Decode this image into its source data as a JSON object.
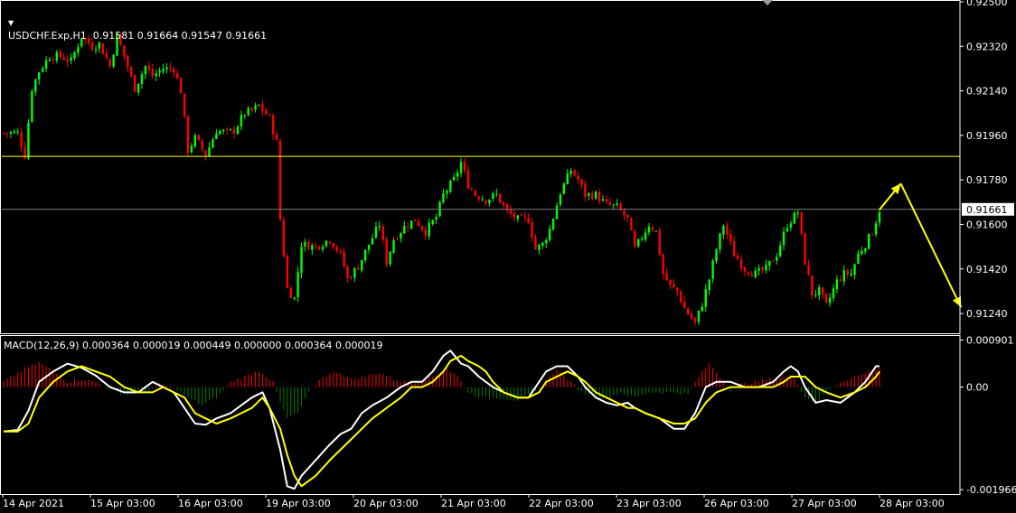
{
  "header": {
    "symbol_line": "USDCHF.Exp,H1  0.91581 0.91664 0.91547 0.91661",
    "macd_line": "MACD(12,26,9) 0.000364 0.000019 0.000449 0.000000 0.000364 0.000019"
  },
  "colors": {
    "background": "#000000",
    "axis": "#ffffff",
    "bull_candle": "#00ff00",
    "bear_candle": "#ff0000",
    "level_line": "#ffff00",
    "price_line": "#808080",
    "arrow": "#ffff00",
    "macd_main": "#ffffff",
    "macd_signal": "#ffff00",
    "hist_positive": "#ff0000",
    "hist_negative": "#008000"
  },
  "chart_data": [
    {
      "type": "candlestick",
      "title": "USDCHF.Exp,H1",
      "timeframe": "H1",
      "last_price_label": "0.91661",
      "ylim": [
        0.9116,
        0.925
      ],
      "y_ticks": [
        "0.92500",
        "0.92320",
        "0.92140",
        "0.91960",
        "0.91780",
        "0.91600",
        "0.91420",
        "0.91240"
      ],
      "y_tick_values": [
        0.925,
        0.9232,
        0.9214,
        0.9196,
        0.9178,
        0.916,
        0.9142,
        0.9124
      ],
      "x_ticks": [
        "14 Apr 2021",
        "15 Apr 03:00",
        "16 Apr 03:00",
        "19 Apr 03:00",
        "20 Apr 03:00",
        "21 Apr 03:00",
        "22 Apr 03:00",
        "23 Apr 03:00",
        "26 Apr 03:00",
        "27 Apr 03:00",
        "28 Apr 03:00"
      ],
      "close_path": [
        [
          0,
          0.9197
        ],
        [
          4,
          0.9197
        ],
        [
          6,
          0.9188
        ],
        [
          8,
          0.9215
        ],
        [
          10,
          0.9222
        ],
        [
          13,
          0.9228
        ],
        [
          16,
          0.9228
        ],
        [
          19,
          0.9226
        ],
        [
          22,
          0.9236
        ],
        [
          25,
          0.9232
        ],
        [
          27,
          0.9233
        ],
        [
          30,
          0.9224
        ],
        [
          32,
          0.9236
        ],
        [
          34,
          0.9228
        ],
        [
          37,
          0.9215
        ],
        [
          40,
          0.9224
        ],
        [
          42,
          0.922
        ],
        [
          45,
          0.9223
        ],
        [
          48,
          0.9223
        ],
        [
          50,
          0.9214
        ],
        [
          52,
          0.919
        ],
        [
          54,
          0.9195
        ],
        [
          57,
          0.9188
        ],
        [
          60,
          0.9198
        ],
        [
          63,
          0.9197
        ],
        [
          65,
          0.9198
        ],
        [
          68,
          0.9205
        ],
        [
          70,
          0.9206
        ],
        [
          72,
          0.9208
        ],
        [
          75,
          0.9203
        ],
        [
          77,
          0.9193
        ],
        [
          78,
          0.9162
        ],
        [
          80,
          0.9134
        ],
        [
          82,
          0.913
        ],
        [
          84,
          0.9152
        ],
        [
          88,
          0.9151
        ],
        [
          92,
          0.9154
        ],
        [
          95,
          0.9148
        ],
        [
          97,
          0.9138
        ],
        [
          100,
          0.9143
        ],
        [
          103,
          0.9152
        ],
        [
          106,
          0.916
        ],
        [
          108,
          0.9145
        ],
        [
          110,
          0.9154
        ],
        [
          113,
          0.9159
        ],
        [
          116,
          0.9162
        ],
        [
          119,
          0.9157
        ],
        [
          122,
          0.9163
        ],
        [
          124,
          0.9172
        ],
        [
          127,
          0.9178
        ],
        [
          129,
          0.9185
        ],
        [
          131,
          0.9176
        ],
        [
          133,
          0.9172
        ],
        [
          136,
          0.917
        ],
        [
          139,
          0.9172
        ],
        [
          142,
          0.9165
        ],
        [
          145,
          0.9162
        ],
        [
          148,
          0.9162
        ],
        [
          150,
          0.915
        ],
        [
          152,
          0.9152
        ],
        [
          154,
          0.9158
        ],
        [
          157,
          0.9173
        ],
        [
          160,
          0.9182
        ],
        [
          162,
          0.9178
        ],
        [
          164,
          0.9172
        ],
        [
          167,
          0.9172
        ],
        [
          170,
          0.9168
        ],
        [
          173,
          0.9167
        ],
        [
          176,
          0.9162
        ],
        [
          178,
          0.915
        ],
        [
          180,
          0.9155
        ],
        [
          182,
          0.916
        ],
        [
          184,
          0.9157
        ],
        [
          186,
          0.914
        ],
        [
          188,
          0.9135
        ],
        [
          190,
          0.9133
        ],
        [
          192,
          0.9126
        ],
        [
          195,
          0.912
        ],
        [
          197,
          0.9128
        ],
        [
          199,
          0.9138
        ],
        [
          201,
          0.915
        ],
        [
          203,
          0.916
        ],
        [
          206,
          0.9148
        ],
        [
          209,
          0.9142
        ],
        [
          212,
          0.914
        ],
        [
          215,
          0.9142
        ],
        [
          218,
          0.9148
        ],
        [
          221,
          0.916
        ],
        [
          224,
          0.9165
        ],
        [
          226,
          0.9145
        ],
        [
          228,
          0.9132
        ],
        [
          230,
          0.9133
        ],
        [
          232,
          0.9127
        ],
        [
          235,
          0.9137
        ],
        [
          237,
          0.914
        ],
        [
          239,
          0.914
        ],
        [
          241,
          0.9148
        ],
        [
          243,
          0.9152
        ],
        [
          245,
          0.9157
        ],
        [
          247,
          0.9166
        ]
      ],
      "horizontal_lines": [
        {
          "name": "level",
          "value": 0.91875,
          "color": "#ffff00"
        },
        {
          "name": "current-price",
          "value": 0.91661,
          "color": "#808080"
        }
      ],
      "forecast_arrows": [
        {
          "from": [
            247,
            0.9166
          ],
          "to": [
            253,
            0.91765
          ]
        },
        {
          "from": [
            253,
            0.91765
          ],
          "to": [
            270,
            0.91265
          ]
        }
      ]
    },
    {
      "type": "macd",
      "title": "MACD(12,26,9)",
      "params": [
        12,
        26,
        9
      ],
      "ylim": [
        -0.00205,
        0.00098
      ],
      "y_ticks": [
        "0.000901",
        "0.00",
        "-0.001966"
      ],
      "y_tick_values": [
        0.000901,
        0.0,
        -0.001966
      ],
      "histogram": [
        [
          0,
          0.0001
        ],
        [
          6,
          0.00035
        ],
        [
          10,
          0.00047
        ],
        [
          14,
          0.0003
        ],
        [
          18,
          0.0001
        ],
        [
          22,
          0.00015
        ],
        [
          26,
          0.0001
        ],
        [
          30,
          -5e-05
        ],
        [
          35,
          -0.00015
        ],
        [
          40,
          -0.0001
        ],
        [
          44,
          5e-05
        ],
        [
          48,
          0.0
        ],
        [
          52,
          -0.0002
        ],
        [
          56,
          -0.00035
        ],
        [
          60,
          -0.0002
        ],
        [
          64,
          0.0001
        ],
        [
          68,
          0.0002
        ],
        [
          72,
          0.00032
        ],
        [
          76,
          0.0001
        ],
        [
          78,
          -0.0003
        ],
        [
          80,
          -0.0006
        ],
        [
          83,
          -0.0005
        ],
        [
          86,
          -0.0001
        ],
        [
          90,
          0.0002
        ],
        [
          94,
          0.0003
        ],
        [
          98,
          0.00015
        ],
        [
          102,
          0.0002
        ],
        [
          106,
          0.00028
        ],
        [
          110,
          0.00015
        ],
        [
          113,
          0.0001
        ],
        [
          117,
          0.0001
        ],
        [
          121,
          0.0002
        ],
        [
          125,
          0.00035
        ],
        [
          128,
          0.0002
        ],
        [
          131,
          -0.0001
        ],
        [
          135,
          -0.0002
        ],
        [
          140,
          -0.0002
        ],
        [
          145,
          -0.00025
        ],
        [
          150,
          -0.0001
        ],
        [
          153,
          0.0001
        ],
        [
          156,
          0.00035
        ],
        [
          159,
          0.00015
        ],
        [
          163,
          -0.0001
        ],
        [
          166,
          -0.00015
        ],
        [
          170,
          -0.0002
        ],
        [
          174,
          -0.0001
        ],
        [
          178,
          -0.0002
        ],
        [
          182,
          -0.0001
        ],
        [
          186,
          -0.0001
        ],
        [
          190,
          -0.0001
        ],
        [
          193,
          -0.00015
        ],
        [
          196,
          0.0002
        ],
        [
          199,
          0.00045
        ],
        [
          202,
          0.0002
        ],
        [
          205,
          -5e-05
        ],
        [
          208,
          5e-05
        ],
        [
          212,
          0.0001
        ],
        [
          216,
          0.00015
        ],
        [
          220,
          0.0002
        ],
        [
          223,
          0.0002
        ],
        [
          226,
          -0.0002
        ],
        [
          229,
          -0.0003
        ],
        [
          232,
          -0.0001
        ],
        [
          236,
          0.0001
        ],
        [
          240,
          0.0002
        ],
        [
          244,
          0.0003
        ],
        [
          247,
          0.00036
        ]
      ],
      "main": [
        [
          0,
          -0.00085
        ],
        [
          4,
          -0.00082
        ],
        [
          7,
          -0.00045
        ],
        [
          10,
          0.0001
        ],
        [
          14,
          0.0003
        ],
        [
          18,
          0.00045
        ],
        [
          22,
          0.00037
        ],
        [
          26,
          0.00022
        ],
        [
          30,
          0.0
        ],
        [
          34,
          -0.0001
        ],
        [
          38,
          -0.0001
        ],
        [
          42,
          0.0001
        ],
        [
          45,
          0.0
        ],
        [
          48,
          -0.0001
        ],
        [
          51,
          -0.0004
        ],
        [
          54,
          -0.0007
        ],
        [
          57,
          -0.00072
        ],
        [
          60,
          -0.0006
        ],
        [
          64,
          -0.0005
        ],
        [
          67,
          -0.00035
        ],
        [
          70,
          -0.0002
        ],
        [
          73,
          -0.0001
        ],
        [
          75,
          -0.0004
        ],
        [
          78,
          -0.0012
        ],
        [
          80,
          -0.0019
        ],
        [
          82,
          -0.00195
        ],
        [
          84,
          -0.0017
        ],
        [
          88,
          -0.0014
        ],
        [
          92,
          -0.0011
        ],
        [
          95,
          -0.0009
        ],
        [
          98,
          -0.0008
        ],
        [
          101,
          -0.0005
        ],
        [
          104,
          -0.00035
        ],
        [
          108,
          -0.0002
        ],
        [
          112,
          0.0
        ],
        [
          115,
          0.0001
        ],
        [
          118,
          0.0001
        ],
        [
          121,
          0.0003
        ],
        [
          124,
          0.0006
        ],
        [
          126,
          0.0007
        ],
        [
          129,
          0.00045
        ],
        [
          131,
          0.0004
        ],
        [
          134,
          0.0002
        ],
        [
          136,
          0.0001
        ],
        [
          138,
          0.0
        ],
        [
          141,
          -0.0001
        ],
        [
          145,
          -0.0002
        ],
        [
          148,
          -0.0002
        ],
        [
          151,
          0.0001
        ],
        [
          153,
          0.0003
        ],
        [
          156,
          0.0004
        ],
        [
          159,
          0.0004
        ],
        [
          162,
          0.0002
        ],
        [
          164,
          0.0
        ],
        [
          167,
          -0.0002
        ],
        [
          170,
          -0.0003
        ],
        [
          173,
          -0.00035
        ],
        [
          176,
          -0.0003
        ],
        [
          178,
          -0.0004
        ],
        [
          181,
          -0.0005
        ],
        [
          185,
          -0.0006
        ],
        [
          189,
          -0.0008
        ],
        [
          192,
          -0.0008
        ],
        [
          195,
          -0.0005
        ],
        [
          198,
          0.0
        ],
        [
          201,
          0.0001
        ],
        [
          205,
          0.0001
        ],
        [
          209,
          0.0
        ],
        [
          213,
          0.0
        ],
        [
          217,
          0.0001
        ],
        [
          220,
          0.0003
        ],
        [
          222,
          0.0004
        ],
        [
          224,
          0.0003
        ],
        [
          226,
          0.0
        ],
        [
          229,
          -0.0003
        ],
        [
          232,
          -0.00025
        ],
        [
          236,
          -0.0003
        ],
        [
          240,
          -0.0001
        ],
        [
          243,
          0.0001
        ],
        [
          246,
          0.0004
        ],
        [
          247,
          0.0004
        ]
      ],
      "signal": [
        [
          0,
          -0.00085
        ],
        [
          4,
          -0.00085
        ],
        [
          7,
          -0.0007
        ],
        [
          10,
          -0.0002
        ],
        [
          14,
          0.0001
        ],
        [
          18,
          0.0003
        ],
        [
          22,
          0.0004
        ],
        [
          26,
          0.0003
        ],
        [
          30,
          0.0002
        ],
        [
          34,
          0.0
        ],
        [
          38,
          -0.0001
        ],
        [
          42,
          -0.0001
        ],
        [
          45,
          0.0
        ],
        [
          48,
          -0.0001
        ],
        [
          51,
          -0.0002
        ],
        [
          54,
          -0.0005
        ],
        [
          57,
          -0.0006
        ],
        [
          60,
          -0.0007
        ],
        [
          64,
          -0.0006
        ],
        [
          67,
          -0.0005
        ],
        [
          70,
          -0.0004
        ],
        [
          73,
          -0.0002
        ],
        [
          75,
          -0.0004
        ],
        [
          78,
          -0.0008
        ],
        [
          80,
          -0.0013
        ],
        [
          82,
          -0.0017
        ],
        [
          84,
          -0.0019
        ],
        [
          88,
          -0.0017
        ],
        [
          92,
          -0.0014
        ],
        [
          95,
          -0.0012
        ],
        [
          98,
          -0.001
        ],
        [
          101,
          -0.0008
        ],
        [
          104,
          -0.0006
        ],
        [
          108,
          -0.0004
        ],
        [
          112,
          -0.0002
        ],
        [
          115,
          0.0
        ],
        [
          118,
          0.0
        ],
        [
          121,
          0.0001
        ],
        [
          124,
          0.0003
        ],
        [
          126,
          0.0005
        ],
        [
          129,
          0.0006
        ],
        [
          131,
          0.0005
        ],
        [
          134,
          0.0004
        ],
        [
          136,
          0.0003
        ],
        [
          138,
          0.0001
        ],
        [
          141,
          -0.0001
        ],
        [
          145,
          -0.0002
        ],
        [
          148,
          -0.0002
        ],
        [
          151,
          -0.0001
        ],
        [
          153,
          0.0001
        ],
        [
          156,
          0.0002
        ],
        [
          159,
          0.0003
        ],
        [
          162,
          0.0002
        ],
        [
          164,
          0.0001
        ],
        [
          167,
          -0.0001
        ],
        [
          170,
          -0.0002
        ],
        [
          173,
          -0.0003
        ],
        [
          176,
          -0.0004
        ],
        [
          178,
          -0.0004
        ],
        [
          181,
          -0.0005
        ],
        [
          185,
          -0.0006
        ],
        [
          189,
          -0.0007
        ],
        [
          192,
          -0.0007
        ],
        [
          195,
          -0.0006
        ],
        [
          198,
          -0.0003
        ],
        [
          201,
          -0.0001
        ],
        [
          205,
          0.0
        ],
        [
          209,
          0.0
        ],
        [
          213,
          0.0
        ],
        [
          217,
          0.0
        ],
        [
          220,
          0.0001
        ],
        [
          222,
          0.0002
        ],
        [
          224,
          0.0002
        ],
        [
          226,
          0.0002
        ],
        [
          229,
          0.0
        ],
        [
          232,
          -0.0001
        ],
        [
          236,
          -0.0002
        ],
        [
          240,
          -0.0001
        ],
        [
          243,
          0.0
        ],
        [
          246,
          0.0002
        ],
        [
          247,
          0.0003
        ]
      ]
    }
  ]
}
